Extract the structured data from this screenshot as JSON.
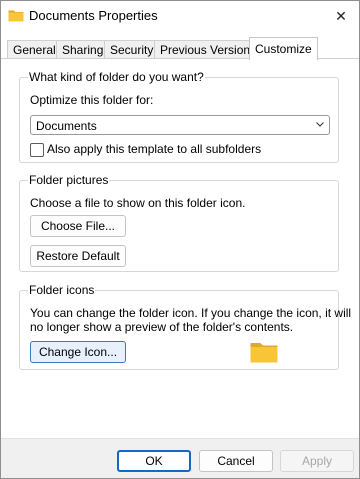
{
  "window": {
    "title": "Documents Properties",
    "close_glyph": "✕"
  },
  "tabs": [
    {
      "label": "General"
    },
    {
      "label": "Sharing"
    },
    {
      "label": "Security"
    },
    {
      "label": "Previous Versions"
    },
    {
      "label": "Customize",
      "active": true
    }
  ],
  "folder_type": {
    "group_title": "What kind of folder do you want?",
    "optimize_label": "Optimize this folder for:",
    "selected_value": "Documents",
    "apply_subfolders_label": "Also apply this template to all subfolders",
    "apply_subfolders_checked": false
  },
  "folder_pictures": {
    "group_title": "Folder pictures",
    "description": "Choose a file to show on this folder icon.",
    "choose_file_label": "Choose File...",
    "restore_default_label": "Restore Default"
  },
  "folder_icons": {
    "group_title": "Folder icons",
    "description_line1": "You can change the folder icon. If you change the icon, it will",
    "description_line2": "no longer show a preview of the folder's contents.",
    "change_icon_label": "Change Icon..."
  },
  "footer": {
    "ok_label": "OK",
    "cancel_label": "Cancel",
    "apply_label": "Apply"
  },
  "colors": {
    "folder_yellow": "#f8c537",
    "accent_blue": "#1a66c2"
  },
  "icons": {
    "title": "folder-icon",
    "close": "close-icon",
    "dropdown": "chevron-down-icon",
    "preview": "folder-icon"
  }
}
